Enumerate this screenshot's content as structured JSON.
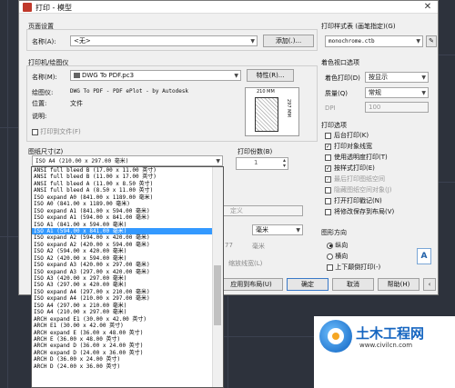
{
  "window": {
    "title": "打印 - 模型",
    "close": "✕"
  },
  "page_setup": {
    "section_label": "页面设置",
    "name_label": "名称(A):",
    "name_value": "<无>",
    "add_button": "添加(.)..."
  },
  "printer": {
    "section_label": "打印机/绘图仪",
    "name_label": "名称(M):",
    "name_value": "DWG To PDF.pc3",
    "properties_button": "特性(R)...",
    "plotter_label": "绘图仪:",
    "plotter_value": "DWG To PDF - PDF ePlot - by Autodesk",
    "location_label": "位置:",
    "location_value": "文件",
    "description_label": "说明:",
    "print_to_file_label": "打印到文件(F)",
    "preview_width": "210 MM",
    "preview_height": "297 MM"
  },
  "paper_size": {
    "section_label": "图纸尺寸(Z)",
    "selected": "ISO A4 (210.00 x 297.00 毫米)",
    "options": [
      "ANSI full bleed B (17.00 x 11.00 英寸)",
      "ANSI full bleed B (11.00 x 17.00 英寸)",
      "ANSI full bleed A (11.00 x 8.50 英寸)",
      "ANSI full bleed A (8.50 x 11.00 英寸)",
      "ISO expand A0 (841.00 x 1189.00 毫米)",
      "ISO A0 (841.00 x 1189.00 毫米)",
      "ISO expand A1 (841.00 x 594.00 毫米)",
      "ISO expand A1 (594.00 x 841.00 毫米)",
      "ISO A1 (841.00 x 594.00 毫米)",
      "ISO A1 (594.00 x 841.00 毫米)",
      "ISO expand A2 (594.00 x 420.00 毫米)",
      "ISO expand A2 (420.00 x 594.00 毫米)",
      "ISO A2 (594.00 x 420.00 毫米)",
      "ISO A2 (420.00 x 594.00 毫米)",
      "ISO expand A3 (420.00 x 297.00 毫米)",
      "ISO expand A3 (297.00 x 420.00 毫米)",
      "ISO A3 (420.00 x 297.00 毫米)",
      "ISO A3 (297.00 x 420.00 毫米)",
      "ISO expand A4 (297.00 x 210.00 毫米)",
      "ISO expand A4 (210.00 x 297.00 毫米)",
      "ISO A4 (297.00 x 210.00 毫米)",
      "ISO A4 (210.00 x 297.00 毫米)",
      "ARCH expand E1 (30.00 x 42.00 英寸)",
      "ARCH E1 (30.00 x 42.00 英寸)",
      "ARCH expand E (36.00 x 48.00 英寸)",
      "ARCH E (36.00 x 48.00 英寸)",
      "ARCH expand D (36.00 x 24.00 英寸)",
      "ARCH expand D (24.00 x 36.00 英寸)",
      "ARCH D (36.00 x 24.00 英寸)",
      "ARCH D (24.00 x 36.00 英寸)"
    ],
    "highlighted_index": 9
  },
  "copies": {
    "label": "打印份数(B)",
    "value": "1"
  },
  "hidden_partial": {
    "scale_label": "定义",
    "unit_value": "毫米",
    "unit_value2": "77",
    "lineweight_label": "缩放线宽(L)"
  },
  "plot_style": {
    "section_label": "打印样式表 (画笔指定)(G)",
    "value": "monochrome.ctb"
  },
  "shaded_viewport": {
    "section_label": "着色视口选项",
    "shade_label": "着色打印(D)",
    "shade_value": "按显示",
    "quality_label": "质量(Q)",
    "quality_value": "常规",
    "dpi_label": "DPI",
    "dpi_value": "100"
  },
  "plot_options": {
    "section_label": "打印选项",
    "items": [
      {
        "label": "后台打印(K)",
        "checked": false,
        "disabled": false
      },
      {
        "label": "打印对象线宽",
        "checked": true,
        "disabled": false
      },
      {
        "label": "使用透明度打印(T)",
        "checked": false,
        "disabled": false
      },
      {
        "label": "按样式打印(E)",
        "checked": true,
        "disabled": false
      },
      {
        "label": "最后打印图纸空间",
        "checked": true,
        "disabled": true
      },
      {
        "label": "隐藏图纸空间对象(J)",
        "checked": false,
        "disabled": true
      },
      {
        "label": "打开打印戳记(N)",
        "checked": false,
        "disabled": false
      },
      {
        "label": "将修改保存到布局(V)",
        "checked": false,
        "disabled": false
      }
    ]
  },
  "orientation": {
    "section_label": "图形方向",
    "portrait": "纵向",
    "landscape": "横向",
    "upside_down": "上下颠倒打印(-)"
  },
  "footer": {
    "apply_button": "应用到布局(U)",
    "ok_button": "确定",
    "cancel_button": "取消",
    "help_button": "帮助(H)"
  },
  "watermark": {
    "title": "土木工程网",
    "url": "www.civilcn.com"
  }
}
